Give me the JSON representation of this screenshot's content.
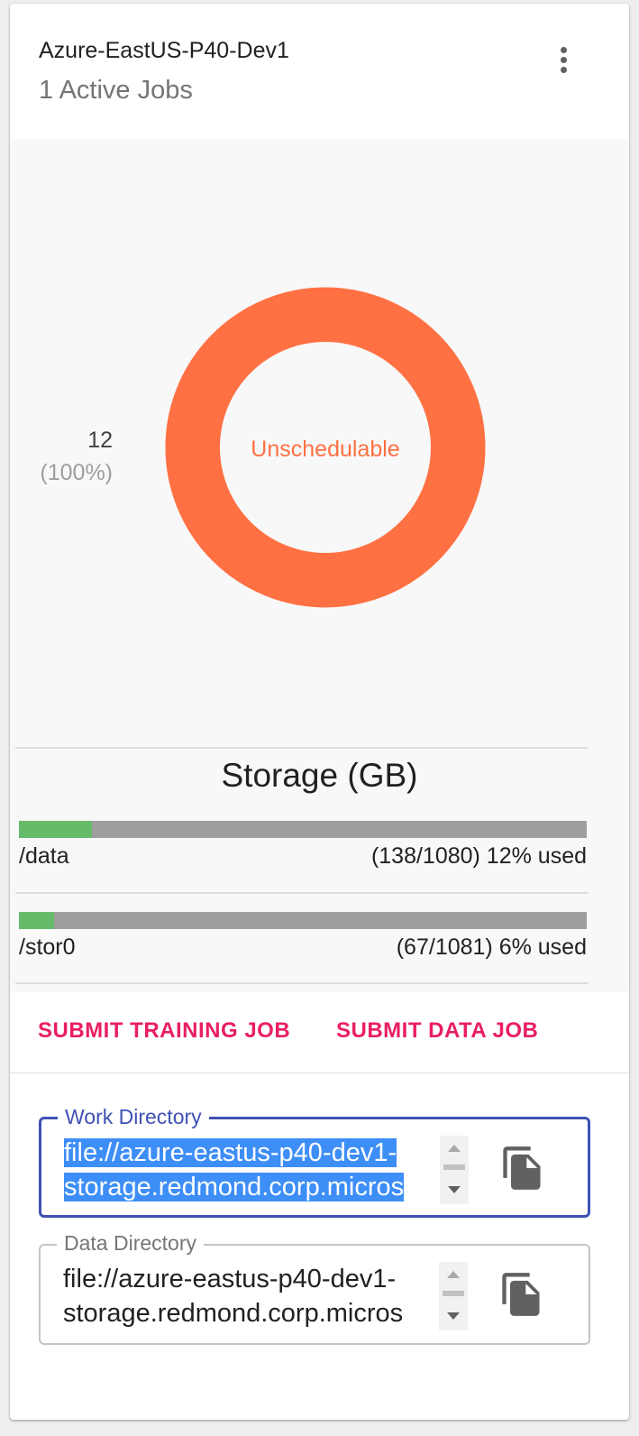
{
  "header": {
    "title": "Azure-EastUS-P40-Dev1",
    "subtitle": "1 Active Jobs",
    "menu_icon": "more-vert-icon"
  },
  "chart_data": {
    "type": "pie",
    "categories": [
      "Unschedulable"
    ],
    "values": [
      12
    ],
    "percentages": [
      "100%"
    ],
    "center_label": "Unschedulable",
    "legend_count": "12",
    "legend_percent": "(100%)",
    "colors": {
      "Unschedulable": "#ff7043"
    }
  },
  "storage": {
    "title": "Storage (GB)",
    "items": [
      {
        "name": "/data",
        "usage": "(138/1080) 12% used",
        "used": 138,
        "total": 1080
      },
      {
        "name": "/stor0",
        "usage": "(67/1081) 6% used",
        "used": 67,
        "total": 1081
      }
    ]
  },
  "actions": {
    "submit_training": "SUBMIT TRAINING JOB",
    "submit_data": "SUBMIT DATA JOB"
  },
  "fields": {
    "work_dir": {
      "label": "Work Directory",
      "line1": "file://azure-eastus-p40-dev1-",
      "line2": "storage.redmond.corp.micros"
    },
    "data_dir": {
      "label": "Data Directory",
      "line1": "file://azure-eastus-p40-dev1-",
      "line2": "storage.redmond.corp.micros"
    }
  },
  "colors": {
    "accent": "#e91e63",
    "focus": "#3f51b5",
    "chart_orange": "#ff7043",
    "bar_used": "#66bb6a",
    "bar_track": "#9e9e9e"
  }
}
